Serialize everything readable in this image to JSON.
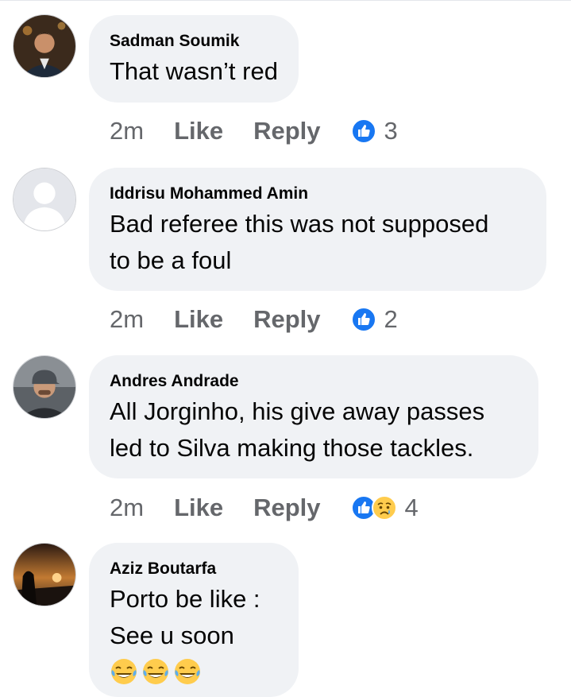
{
  "comments": [
    {
      "avatar_icon": "profile-photo-man-suit",
      "name": "Sadman Soumik",
      "lines": [
        "That wasn’t red"
      ],
      "time": "2m",
      "like": "Like",
      "reply": "Reply",
      "reactions": [
        "like-reaction-icon"
      ],
      "reaction_count": "3"
    },
    {
      "avatar_icon": "default-profile-silhouette",
      "name": "Iddrisu Mohammed Amin",
      "lines": [
        "Bad referee this was not supposed",
        "to be a foul"
      ],
      "time": "2m",
      "like": "Like",
      "reply": "Reply",
      "reactions": [
        "like-reaction-icon"
      ],
      "reaction_count": "2"
    },
    {
      "avatar_icon": "profile-photo-man-cap",
      "name": "Andres Andrade",
      "lines": [
        "All Jorginho, his give away passes",
        "led to Silva making those tackles."
      ],
      "time": "2m",
      "like": "Like",
      "reply": "Reply",
      "reactions": [
        "like-reaction-icon",
        "sad-reaction-icon"
      ],
      "reaction_count": "4"
    },
    {
      "avatar_icon": "profile-photo-sunset",
      "name": "Aziz Boutarfa",
      "lines": [
        "Porto be like :",
        "See u soon"
      ],
      "emoji": [
        "laughing-tears-emoji",
        "laughing-tears-emoji",
        "laughing-tears-emoji"
      ]
    }
  ],
  "colors": {
    "bubble": "#f0f2f5",
    "meta": "#65676b",
    "like_blue": "#1877f2",
    "emoji_yellow": "#ffcc4d"
  }
}
